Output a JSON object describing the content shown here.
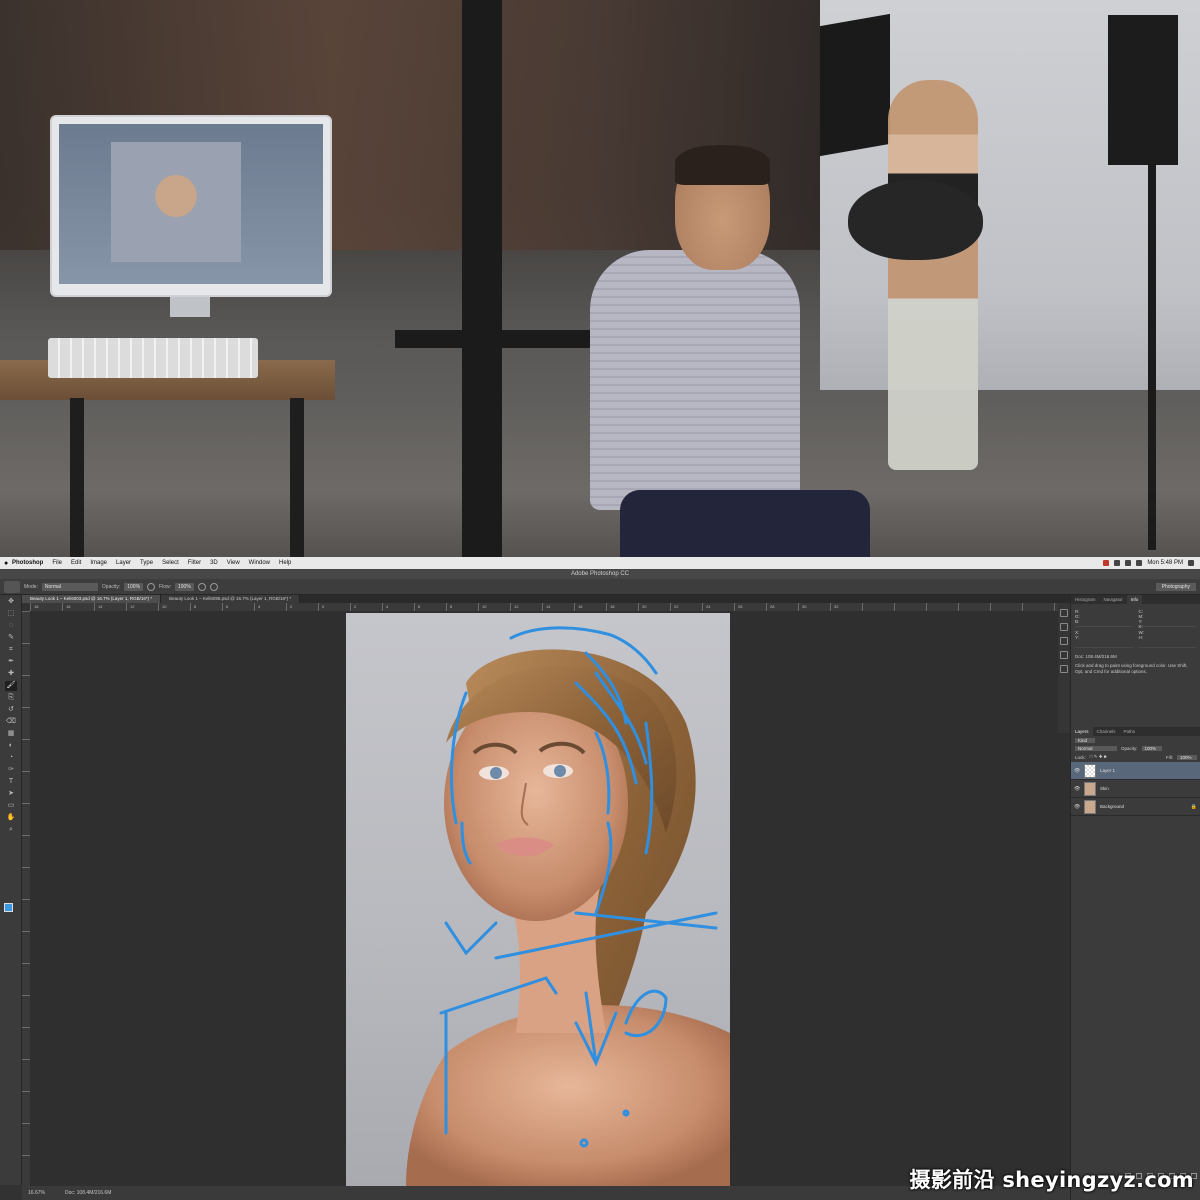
{
  "menubar": {
    "app_name": "Photoshop",
    "items": [
      "File",
      "Edit",
      "Image",
      "Layer",
      "Type",
      "Select",
      "Filter",
      "3D",
      "View",
      "Window",
      "Help"
    ],
    "clock": "Mon 5:48 PM"
  },
  "window": {
    "title": "Adobe Photoshop CC"
  },
  "options_bar": {
    "mode_label": "Mode:",
    "mode_value": "Normal",
    "opacity_label": "Opacity:",
    "opacity_value": "100%",
    "flow_label": "Flow:",
    "flow_value": "100%",
    "workspace": "Photography"
  },
  "document_tabs": [
    {
      "label": "Beauty Look 1 – Keli6003.psd @ 16.7% (Layer 1, RGB/16*) *",
      "active": true
    },
    {
      "label": "Beauty Look 1 – Keli6095.psd @ 16.7% (Layer 1, RGB/16*) *",
      "active": false
    }
  ],
  "ruler_ticks": [
    "18",
    "16",
    "14",
    "12",
    "10",
    "8",
    "6",
    "4",
    "2",
    "0",
    "2",
    "4",
    "6",
    "8",
    "10",
    "12",
    "14",
    "16",
    "18",
    "20",
    "22",
    "24",
    "26",
    "28",
    "30",
    "32"
  ],
  "status_bar": {
    "zoom": "16.67%",
    "doc_info": "Doc: 108.4M/216.6M"
  },
  "panels": {
    "top_tabs": [
      "Histogram",
      "Navigator",
      "Info"
    ],
    "info": {
      "rgb_label": "R:\nG:\nB:",
      "cmyk_label": "C:\nM:\nY:\nK:",
      "bit_depth": "8-bit",
      "xy_label": "X:\nY:",
      "wh_label": "W:\nH:",
      "doc_size": "Doc: 108.4M/216.6M",
      "hint": "Click and drag to paint using foreground color. Use Shift, Opt, and Cmd for additional options."
    },
    "layers_tabs": [
      "Layers",
      "Channels",
      "Paths"
    ],
    "kind_label": "Kind",
    "blend_mode": "Normal",
    "opacity_label": "Opacity:",
    "opacity_value": "100%",
    "lock_label": "Lock:",
    "fill_label": "Fill:",
    "fill_value": "100%",
    "layers": [
      {
        "name": "Layer 1",
        "selected": true,
        "thumb": "blank"
      },
      {
        "name": "Skin",
        "selected": false,
        "thumb": "photo"
      },
      {
        "name": "Background",
        "selected": false,
        "thumb": "photo",
        "locked": true
      }
    ]
  },
  "tools": [
    "move-tool",
    "marquee-tool",
    "lasso-tool",
    "quick-select-tool",
    "crop-tool",
    "eyedropper-tool",
    "healing-tool",
    "brush-tool",
    "clone-tool",
    "history-brush-tool",
    "eraser-tool",
    "gradient-tool",
    "blur-tool",
    "dodge-tool",
    "pen-tool",
    "type-tool",
    "path-select-tool",
    "shape-tool",
    "hand-tool",
    "zoom-tool"
  ],
  "colors": {
    "foreground": "#3b9ae1",
    "background": "#ffffff",
    "annotation_stroke": "#2f8fe0"
  },
  "watermark": "摄影前沿 sheyingzyz.com"
}
